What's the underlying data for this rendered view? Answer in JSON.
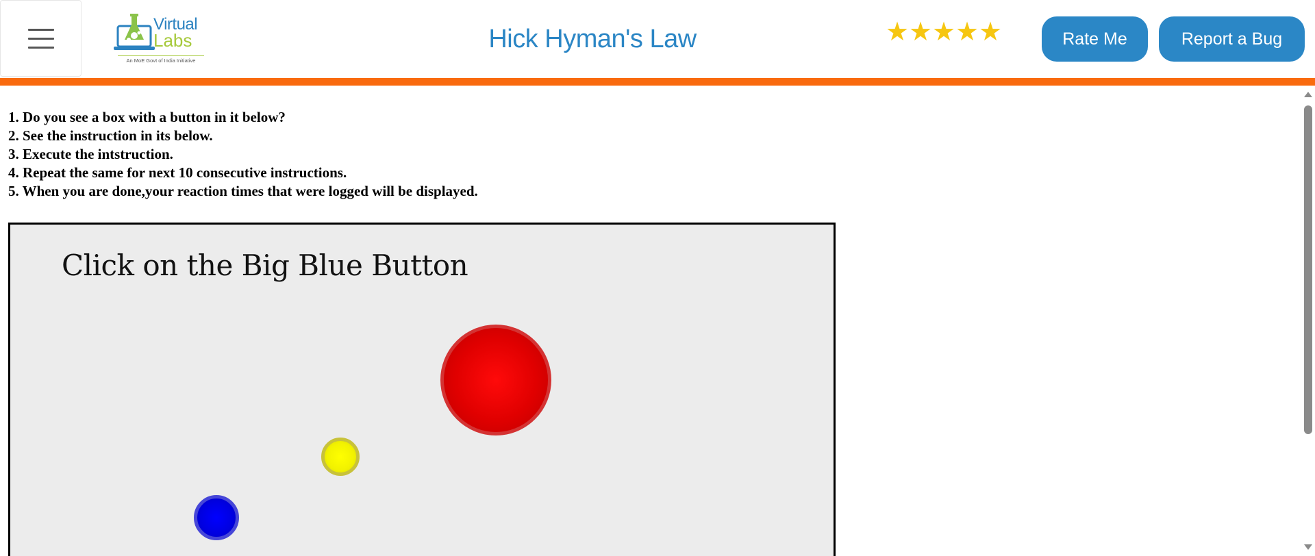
{
  "header": {
    "logo": {
      "line1": "Virtual",
      "line2": "Labs",
      "tagline": "An MoE Govt of India Initiative"
    },
    "title": "Hick Hyman's Law",
    "rating": {
      "stars": 5
    },
    "buttons": {
      "rate": "Rate Me",
      "report": "Report a Bug"
    }
  },
  "instructions": [
    "1. Do you see a box with a button in it below?",
    "2. See the instruction in its below.",
    "3. Execute the intstruction.",
    "4. Repeat the same for next 10 consecutive instructions.",
    "5. When you are done,your reaction times that were logged will be displayed."
  ],
  "experiment": {
    "instruction": "Click on the Big Blue Button",
    "buttons": [
      {
        "name": "red-circle-button",
        "color": "#ff0000"
      },
      {
        "name": "yellow-circle-button",
        "color": "#ffff00"
      },
      {
        "name": "blue-circle-button",
        "color": "#0000ff"
      }
    ]
  },
  "colors": {
    "accent": "#2b87c6",
    "header_stripe": "#f96a0e",
    "star": "#f6c611"
  }
}
